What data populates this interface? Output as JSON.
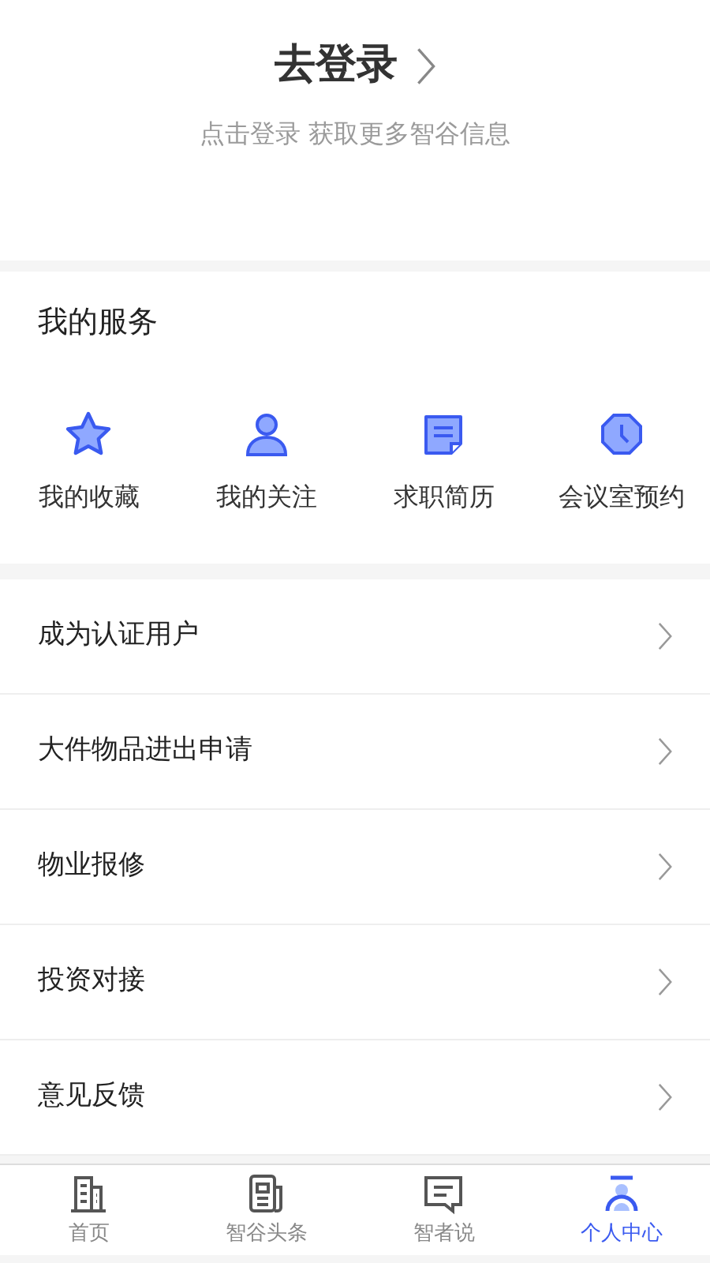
{
  "login": {
    "title": "去登录",
    "subtitle": "点击登录 获取更多智谷信息"
  },
  "services": {
    "title": "我的服务",
    "items": [
      {
        "kind": "star",
        "label": "我的收藏"
      },
      {
        "kind": "person",
        "label": "我的关注"
      },
      {
        "kind": "resume",
        "label": "求职简历"
      },
      {
        "kind": "clock",
        "label": "会议室预约"
      }
    ]
  },
  "menu": [
    "成为认证用户",
    "大件物品进出申请",
    "物业报修",
    "投资对接",
    "意见反馈"
  ],
  "tabs": [
    {
      "kind": "building",
      "label": "首页",
      "selected": false
    },
    {
      "kind": "news",
      "label": "智谷头条",
      "selected": false
    },
    {
      "kind": "chat",
      "label": "智者说",
      "selected": false
    },
    {
      "kind": "user",
      "label": "个人中心",
      "selected": true
    }
  ]
}
